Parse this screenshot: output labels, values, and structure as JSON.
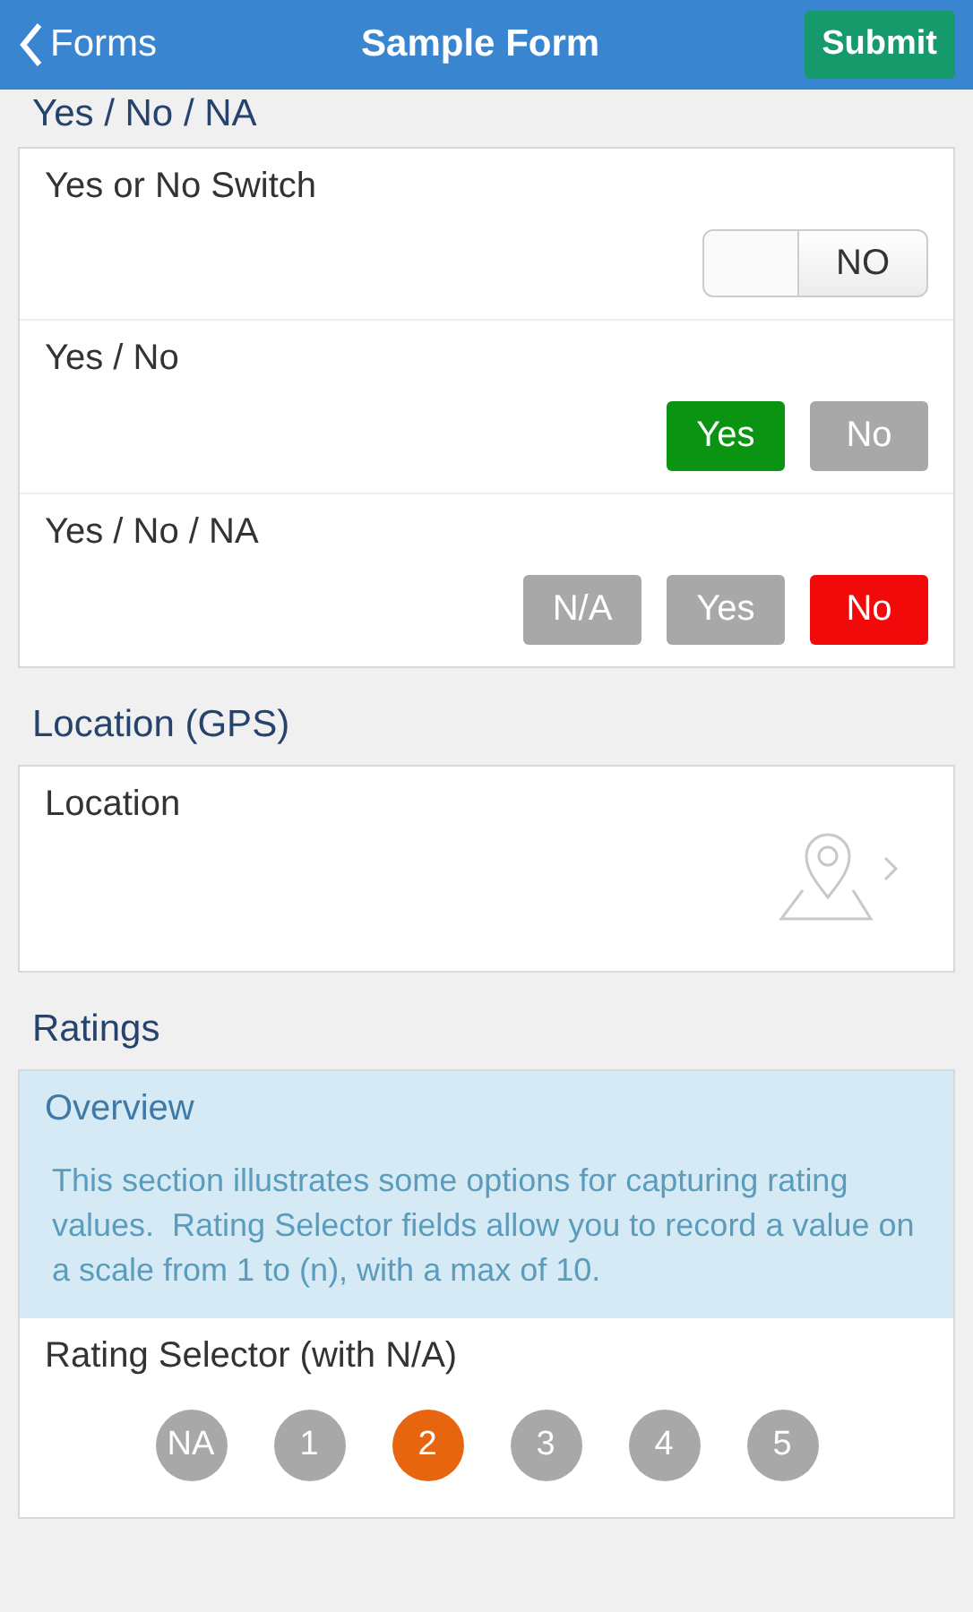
{
  "nav": {
    "back": "Forms",
    "title": "Sample Form",
    "action": "Submit"
  },
  "sections": [
    {
      "title": "Yes / No / NA",
      "fields": [
        {
          "kind": "switch",
          "label": "Yes or No Switch",
          "on": false,
          "off_text": "NO"
        },
        {
          "kind": "buttons",
          "label": "Yes / No",
          "options": [
            {
              "kind": "yes",
              "label": "Yes",
              "selected": true
            },
            {
              "kind": "no",
              "label": "No",
              "selected": false
            }
          ]
        },
        {
          "kind": "buttons",
          "label": "Yes / No / NA",
          "options": [
            {
              "kind": "na",
              "label": "N/A",
              "selected": false
            },
            {
              "kind": "yes",
              "label": "Yes",
              "selected": false
            },
            {
              "kind": "no",
              "label": "No",
              "selected": true
            }
          ]
        }
      ]
    },
    {
      "title": "Location (GPS)",
      "fields": [
        {
          "kind": "location",
          "label": "Location"
        }
      ]
    },
    {
      "title": "Ratings",
      "overview": {
        "title": "Overview",
        "text": "This section illustrates some options for capturing rating values.  Rating Selector fields allow you to record a value on a scale from 1 to (n), with a max of 10."
      },
      "fields": [
        {
          "kind": "rating",
          "label": "Rating Selector (with N/A)",
          "options": [
            {
              "label": "NA",
              "selected": false
            },
            {
              "label": "1",
              "selected": false
            },
            {
              "label": "2",
              "selected": true
            },
            {
              "label": "3",
              "selected": false
            },
            {
              "label": "4",
              "selected": false
            },
            {
              "label": "5",
              "selected": false
            }
          ]
        }
      ]
    }
  ]
}
